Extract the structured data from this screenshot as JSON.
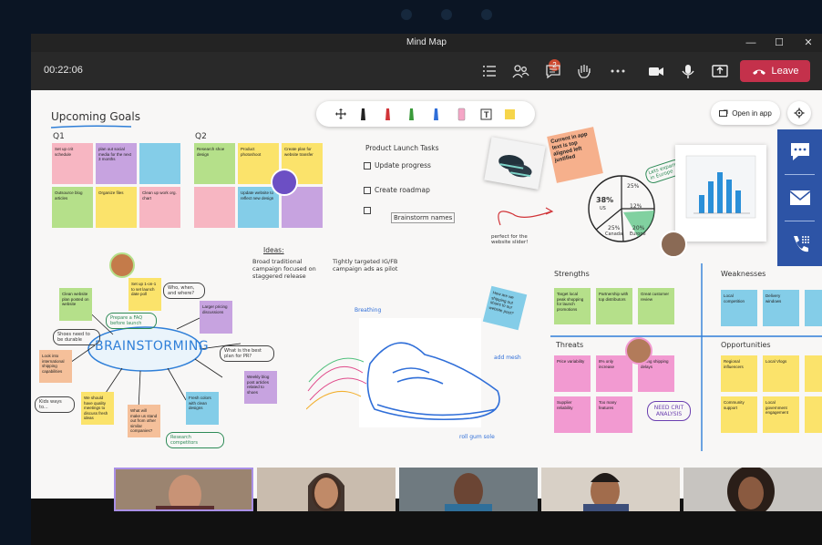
{
  "window": {
    "title": "Mind Map",
    "minimize": "—",
    "maximize": "☐",
    "close": "✕"
  },
  "call": {
    "timer": "00:22:06",
    "badge_count": "2",
    "leave_label": "Leave"
  },
  "whiteboard": {
    "open_in_app": "Open in app",
    "upcoming_goals": "Upcoming Goals",
    "q1": "Q1",
    "q2": "Q2",
    "q1_notes": [
      "Set up crit schedule",
      "plan out social media for the next 3 months",
      "",
      "Outsource blog articles",
      "Organize files",
      "Clean up work org. chart"
    ],
    "q2_notes": [
      "Research shoe design",
      "Product photoshoot",
      "Create plan for website transfer",
      "",
      "Update website to reflect new design",
      ""
    ],
    "tasks_title": "Product Launch Tasks",
    "tasks": [
      "Update progress",
      "Create roadmap",
      "Brainstorm names"
    ],
    "photo_caption": "perfect for the website slider!",
    "salmon_note": "Current in app text is top aligned left justified",
    "pie_labels": [
      "38%",
      "25%",
      "12%",
      "25%",
      "20%"
    ],
    "pie_subs": [
      "US",
      "Canada",
      "Europe"
    ],
    "pie_callout": "Lets expand in Europe",
    "ideas_title": "Ideas:",
    "ideas": [
      "Broad traditional campaign focused on staggered release",
      "Tightly targeted IG/FB campaign ads as pilot"
    ],
    "brainstorm": "BRAINSTORMING",
    "brainstorm_bubbles": [
      "Prepare a FAQ before launch",
      "Who, when, and where?",
      "What is the best plan for PR?",
      "Shoes need to be durable",
      "Kids ways to...",
      "Research competitors"
    ],
    "brainstorm_notes": [
      "Clean website plan posted on website",
      "Set up 1-on-1 to set launch date poll",
      "Larger pricing discussions",
      "Look into international shipping capabilities",
      "Weekly blog post articles related to shoes",
      "We should have quality meetings to discuss fresh ideas",
      "What will make us stand out from other similar companies?",
      "Fresh colors with clean designs"
    ],
    "sketch_words": [
      "Breathing",
      "add mesh",
      "roll gum sole"
    ],
    "blue_note": "How are we shipping out shoes to our website post?",
    "strengths": "Strengths",
    "strengths_notes": [
      "Target local peak shopping for launch promotions",
      "Partnership with top distributors",
      "Great customer review"
    ],
    "weaknesses": "Weaknesses",
    "weaknesses_notes": [
      "Local competition",
      "Delivery windows",
      ""
    ],
    "threats": "Threats",
    "threats_notes": [
      "Price variability",
      "8% only increase",
      "Rising shipping delays",
      "Supplier reliability",
      "Too many features",
      "NEED CRIT ANALYSIS"
    ],
    "opportunities": "Opportunities",
    "opportunities_notes": [
      "Regional influencers",
      "Local Vlogs",
      "",
      "Community support",
      "Local government engagement",
      ""
    ]
  },
  "colors": {
    "leave": "#c4314b",
    "badge": "#cc4a31",
    "yellow": "#fbe36b",
    "pink": "#f7b6c2",
    "purple": "#c7a3e0",
    "blue": "#84cde8",
    "green": "#b5e08a",
    "orange": "#f5c09a",
    "salmon": "#f6b08c",
    "side_panel": "#2d54a6"
  },
  "icons": [
    "chat-icon",
    "mail-icon",
    "phone-icon",
    "participants-icon",
    "hand-icon",
    "more-icon",
    "camera-icon",
    "mic-icon",
    "share-icon",
    "gear-icon"
  ]
}
